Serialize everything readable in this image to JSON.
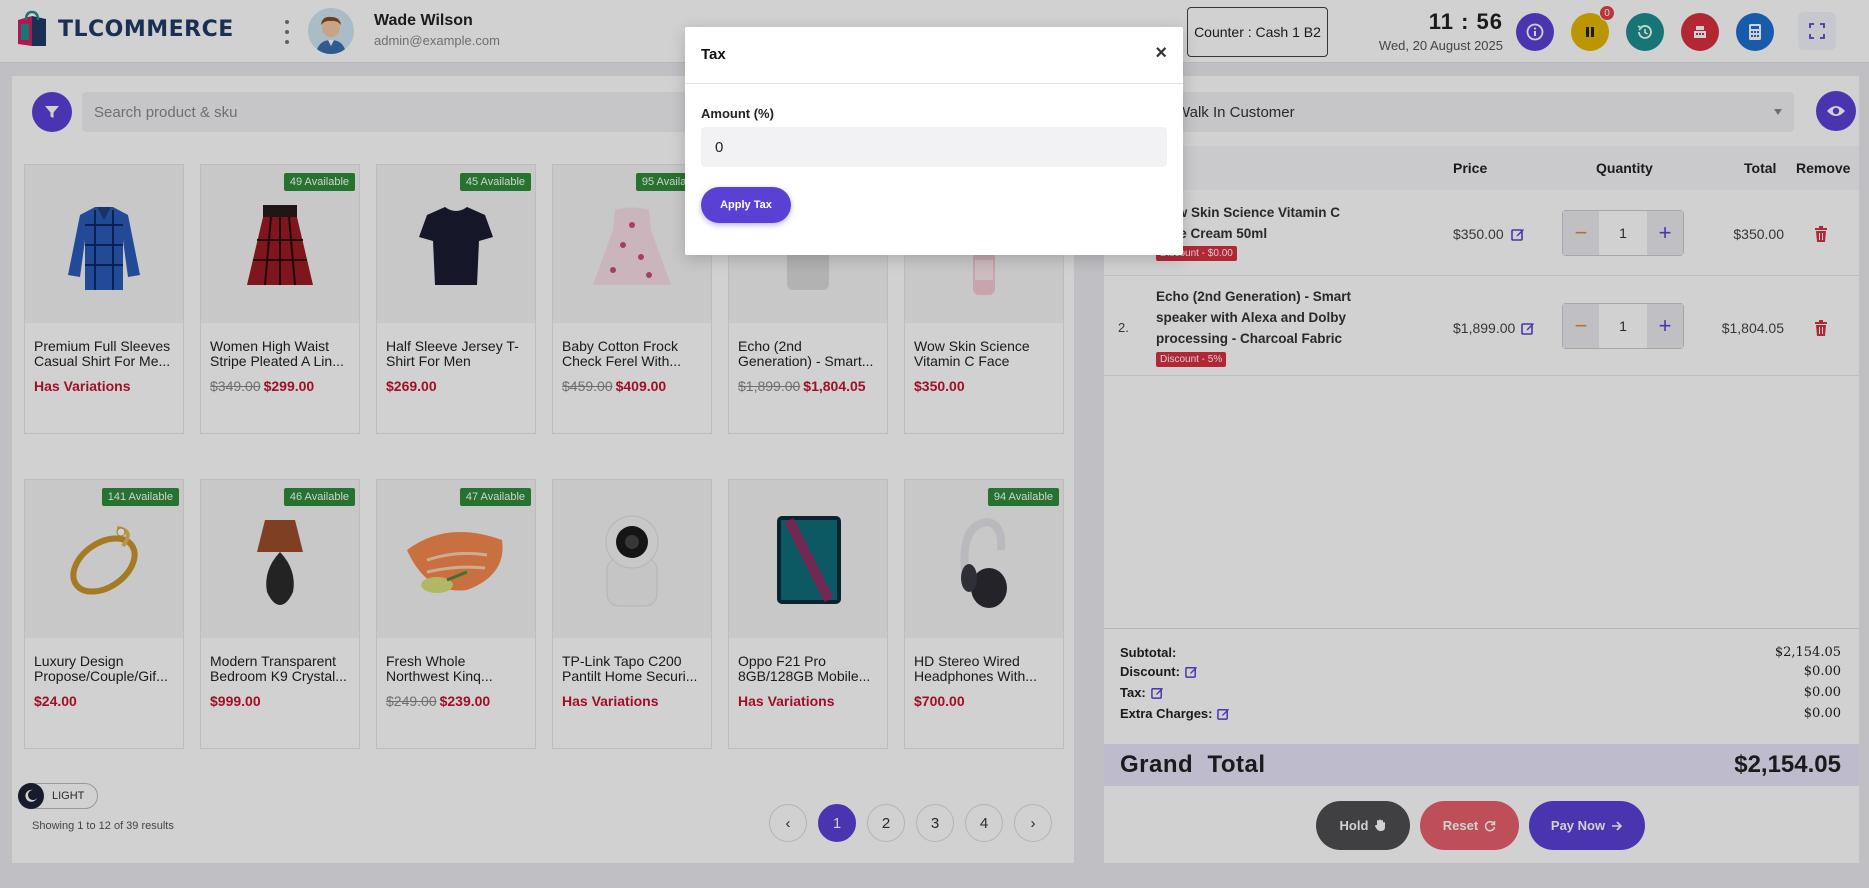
{
  "header": {
    "logo_text": "TLCOMMERCE",
    "user_name": "Wade Wilson",
    "user_email": "admin@example.com",
    "counter_label": "Counter : Cash 1 B2",
    "time": "11 : 56",
    "date": "Wed, 20 August 2025",
    "hold_badge": "0",
    "buttons": [
      {
        "icon": "info-icon",
        "color": "#5b40d6"
      },
      {
        "icon": "pause-icon",
        "color": "#e6b800"
      },
      {
        "icon": "history-icon",
        "color": "#1e8f8f"
      },
      {
        "icon": "register-icon",
        "color": "#d9303f"
      },
      {
        "icon": "calculator-icon",
        "color": "#1f6fd1"
      }
    ]
  },
  "search": {
    "placeholder": "Search product & sku"
  },
  "products": [
    {
      "name": "Premium Full Sleeves Casual Shirt For Me...",
      "availability": "",
      "old_price": "",
      "price": "Has Variations"
    },
    {
      "name": "Women High Waist Stripe Pleated A Lin...",
      "availability": "49 Available",
      "old_price": "$349.00",
      "price": "$299.00"
    },
    {
      "name": "Half Sleeve Jersey T-Shirt For Men",
      "availability": "45 Available",
      "old_price": "",
      "price": "$269.00"
    },
    {
      "name": "Baby Cotton Frock Check Ferel With...",
      "availability": "95 Available",
      "old_price": "$459.00",
      "price": "$409.00"
    },
    {
      "name": "Echo (2nd Generation) - Smart...",
      "availability": "",
      "old_price": "$1,899.00",
      "price": "$1,804.05"
    },
    {
      "name": "Wow Skin Science Vitamin C Face Crea...",
      "availability": "",
      "old_price": "",
      "price": "$350.00"
    },
    {
      "name": "Luxury Design Propose/Couple/Gif...",
      "availability": "141 Available",
      "old_price": "",
      "price": "$24.00"
    },
    {
      "name": "Modern Transparent Bedroom K9 Crystal...",
      "availability": "46 Available",
      "old_price": "",
      "price": "$999.00"
    },
    {
      "name": "Fresh Whole Northwest Kinq...",
      "availability": "47 Available",
      "old_price": "$249.00",
      "price": "$239.00"
    },
    {
      "name": "TP-Link Tapo C200 Pantilt Home Securi...",
      "availability": "",
      "old_price": "",
      "price": "Has Variations"
    },
    {
      "name": "Oppo F21 Pro 8GB/128GB Mobile...",
      "availability": "",
      "old_price": "",
      "price": "Has Variations"
    },
    {
      "name": "HD Stereo Wired Headphones With...",
      "availability": "94 Available",
      "old_price": "",
      "price": "$700.00"
    }
  ],
  "theme_label": "LIGHT",
  "showing_text": "Showing 1 to 12 of 39 results",
  "pagination": {
    "prev": "‹",
    "pages": [
      "1",
      "2",
      "3",
      "4"
    ],
    "next": "›",
    "active": "1"
  },
  "customer": {
    "selected": "Walk In Customer"
  },
  "cart": {
    "headers": {
      "price": "Price",
      "quantity": "Quantity",
      "total": "Total",
      "remove": "Remove"
    },
    "items": [
      {
        "index": "",
        "name": "Wow Skin Science Vitamin C Face Cream 50ml",
        "discount": "Discount - $0.00",
        "price": "$350.00",
        "qty": "1",
        "total": "$350.00"
      },
      {
        "index": "2.",
        "name": "Echo (2nd Generation) - Smart speaker with Alexa and Dolby processing - Charcoal Fabric",
        "discount": "Discount - 5%",
        "price": "$1,899.00",
        "qty": "1",
        "total": "$1,804.05"
      }
    ]
  },
  "summary": {
    "subtotal_label": "Subtotal:",
    "subtotal": "$2,154.05",
    "discount_label": "Discount:",
    "discount": "$0.00",
    "tax_label": "Tax:",
    "tax": "$0.00",
    "extra_label": "Extra Charges:",
    "extra": "$0.00",
    "grand_label": "Grand  Total",
    "grand": "$2,154.05"
  },
  "actions": {
    "hold": "Hold",
    "reset": "Reset",
    "pay": "Pay Now"
  },
  "modal": {
    "title": "Tax",
    "close": "×",
    "amount_label": "Amount (%)",
    "amount_value": "0",
    "apply": "Apply Tax"
  }
}
